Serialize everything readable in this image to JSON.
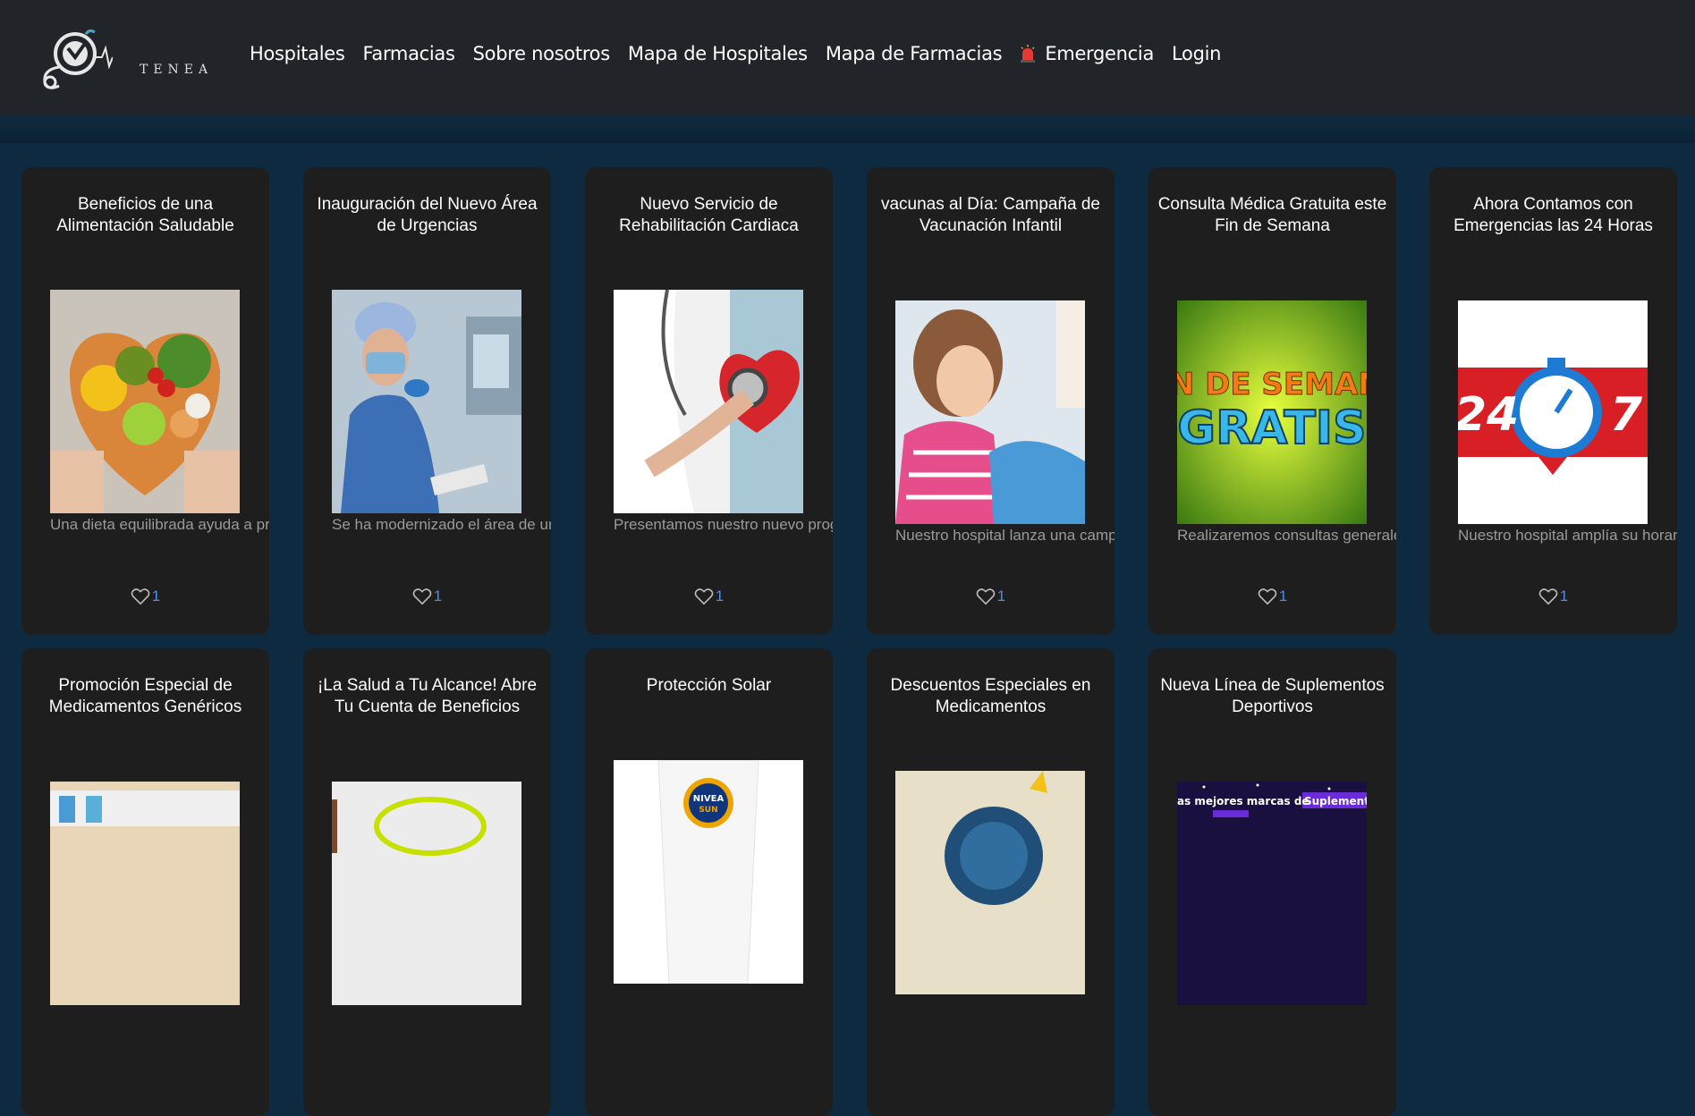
{
  "brand": {
    "name": "TENEA"
  },
  "nav": {
    "items": [
      {
        "label": "Hospitales"
      },
      {
        "label": "Farmacias"
      },
      {
        "label": "Sobre nosotros"
      },
      {
        "label": "Mapa de Hospitales"
      },
      {
        "label": "Mapa de Farmacias"
      },
      {
        "label": "Emergencia",
        "icon": "alarm-icon"
      },
      {
        "label": "Login"
      }
    ]
  },
  "cards": [
    {
      "title": "Beneficios de una Alimentación Saludable",
      "description": "Una dieta equilibrada ayuda a prevenir",
      "likes": "1",
      "image": "healthy-food-heart"
    },
    {
      "title": "Inauguración del Nuevo Área de Urgencias",
      "description": "Se ha modernizado el área de urgencias",
      "likes": "1",
      "image": "surgeon-operating-room"
    },
    {
      "title": "Nuevo Servicio de Rehabilitación Cardiaca",
      "description": "Presentamos nuestro nuevo programa",
      "likes": "1",
      "image": "stethoscope-heart"
    },
    {
      "title": "vacunas al Día: Campaña de Vacunación Infantil",
      "description": "Nuestro hospital lanza una campaña",
      "likes": "1",
      "image": "child-vaccination"
    },
    {
      "title": "Consulta Médica Gratuita este Fin de Semana",
      "description": "Realizaremos consultas generales",
      "likes": "1",
      "image": "fin-de-semana-gratis"
    },
    {
      "title": "Ahora Contamos con Emergencias las 24 Horas",
      "description": "Nuestro hospital amplía su horario",
      "likes": "1",
      "image": "24-7-stopwatch"
    },
    {
      "title": "Promoción Especial de Medicamentos Genéricos",
      "description": "",
      "likes": "",
      "image": "pharmacy-shelves"
    },
    {
      "title": "¡La Salud a Tu Alcance! Abre Tu Cuenta de Beneficios",
      "description": "",
      "likes": "",
      "image": "benefits-card"
    },
    {
      "title": "Protección Solar",
      "description": "",
      "likes": "",
      "image": "nivea-sun"
    },
    {
      "title": "Descuentos Especiales en Medicamentos",
      "description": "",
      "likes": "",
      "image": "discount-badge"
    },
    {
      "title": "Nueva Línea de Suplementos Deportivos",
      "description": "",
      "likes": "",
      "image": "supplements-banner"
    }
  ],
  "image_text": {
    "fin_de_semana": "FIN DE SEMANA",
    "gratis": "GRATIS",
    "h24": "24",
    "h7": "7",
    "nivea": "NIVEA",
    "sun": "SUN",
    "supplements": "as mejores marcas de",
    "supplements_hl": "Suplement"
  },
  "colors": {
    "page_bg": "#0e2a40",
    "navbar_bg": "#212529",
    "card_bg": "#1e1e1e",
    "like_color": "#4d8fe6",
    "description_color": "#9a9a9a"
  }
}
